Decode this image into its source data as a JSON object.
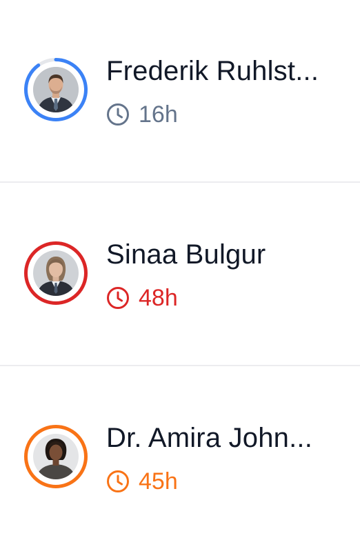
{
  "items": [
    {
      "name": "Frederik Ruhlst...",
      "hours": "16h",
      "ring_color": "#3b82f6",
      "ring_track_color": "#e5e7eb",
      "progress": 0.9,
      "time_color": "#64748b",
      "icon": "clock-icon",
      "avatar": "man-in-suit"
    },
    {
      "name": "Sinaa Bulgur",
      "hours": "48h",
      "ring_color": "#dc2626",
      "ring_track_color": "#e5e7eb",
      "progress": 1.0,
      "time_color": "#dc2626",
      "icon": "clock-icon",
      "avatar": "woman-in-suit"
    },
    {
      "name": "Dr. Amira John...",
      "hours": "45h",
      "ring_color": "#f97316",
      "ring_track_color": "#e5e7eb",
      "progress": 1.0,
      "time_color": "#f97316",
      "icon": "clock-icon",
      "avatar": "woman-dark-shirt"
    }
  ]
}
